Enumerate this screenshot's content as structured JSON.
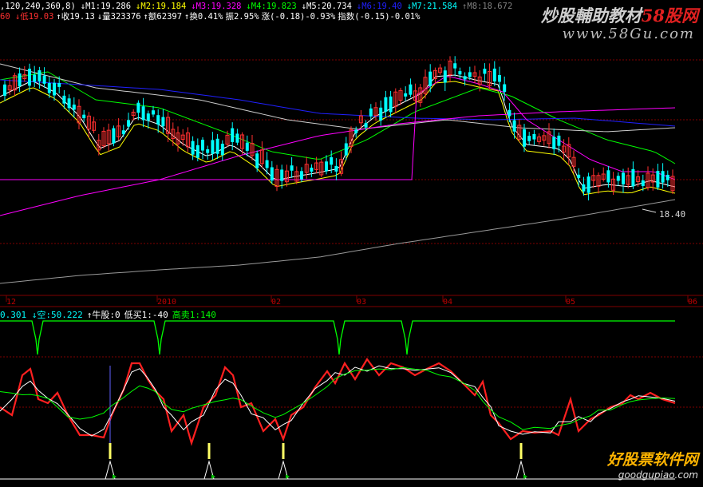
{
  "header": {
    "line1": [
      {
        "text": ",120,240,360,8)",
        "color": "#ffffff"
      },
      {
        "text": "↓M1:19.286",
        "color": "#ffffff"
      },
      {
        "text": "↓M2:19.184",
        "color": "#ffff00"
      },
      {
        "text": "↓M3:19.328",
        "color": "#ff00ff"
      },
      {
        "text": "↓M4:19.823",
        "color": "#00ff00"
      },
      {
        "text": "↓M5:20.734",
        "color": "#ffffff"
      },
      {
        "text": "↓M6:19.40",
        "color": "#2020ff"
      },
      {
        "text": "↓M7:21.584",
        "color": "#00ffff"
      },
      {
        "text": "↑M8:18.672",
        "color": "#808080"
      }
    ],
    "line2": [
      {
        "text": "60 ↓低19.03",
        "color": "#ff3030"
      },
      {
        "text": "↑收19.13",
        "color": "#ffffff"
      },
      {
        "text": "↓量323376",
        "color": "#ffffff"
      },
      {
        "text": "↑额62397",
        "color": "#ffffff"
      },
      {
        "text": "↑换0.41%",
        "color": "#ffffff"
      },
      {
        "text": "振2.95%",
        "color": "#ffffff"
      },
      {
        "text": "涨(-0.18)-0.93%",
        "color": "#ffffff"
      },
      {
        "text": "指数(-0.15)-0.01%",
        "color": "#ffffff"
      }
    ]
  },
  "watermark": {
    "title": "炒股輔助教材",
    "title_red": "58股网",
    "url": "www.58Gu.com"
  },
  "price_annotation": "18.40",
  "x_axis_labels": [
    "12",
    "2010",
    "02",
    "03",
    "04",
    "05",
    "06"
  ],
  "indicator_legend": [
    {
      "text": "0.301 ↓空:50.222",
      "color": "#00ffff"
    },
    {
      "text": "↑牛股:0",
      "color": "#ffffff"
    },
    {
      "text": "低买1:-40",
      "color": "#ffffff"
    },
    {
      "text": "高卖1:140",
      "color": "#00ff00"
    }
  ],
  "logo": {
    "name": "好股票软件网",
    "url": "goodgupiao.com"
  },
  "colors": {
    "background": "#000000",
    "bull_candle": "#ff3030",
    "bear_candle": "#00ffff",
    "grid": "#800000",
    "signal_line": "#00ff00",
    "oscillator_main": "#ff2020",
    "oscillator_fast": "#ffffff",
    "oscillator_slow": "#00ff00",
    "buy_signal": "#ffff66"
  }
}
